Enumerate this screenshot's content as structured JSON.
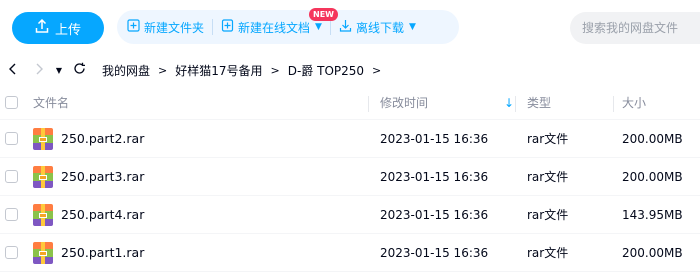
{
  "toolbar": {
    "upload_label": "上传",
    "new_folder_label": "新建文件夹",
    "new_online_doc_label": "新建在线文档",
    "new_badge": "NEW",
    "offline_download_label": "离线下载",
    "search_placeholder": "搜索我的网盘文件"
  },
  "breadcrumb": [
    "我的网盘",
    "好样猫17号备用",
    "D-爵 TOP250"
  ],
  "table": {
    "headers": {
      "name": "文件名",
      "modified": "修改时间",
      "type": "类型",
      "size": "大小"
    },
    "rows": [
      {
        "name": "250.part2.rar",
        "modified": "2023-01-15 16:36",
        "type": "rar文件",
        "size": "200.00MB"
      },
      {
        "name": "250.part3.rar",
        "modified": "2023-01-15 16:36",
        "type": "rar文件",
        "size": "200.00MB"
      },
      {
        "name": "250.part4.rar",
        "modified": "2023-01-15 16:36",
        "type": "rar文件",
        "size": "143.95MB"
      },
      {
        "name": "250.part1.rar",
        "modified": "2023-01-15 16:36",
        "type": "rar文件",
        "size": "200.00MB"
      }
    ]
  },
  "colors": {
    "accent": "#06a7ff",
    "accent_light_bg": "#eef6ff",
    "badge": "#f5365c"
  },
  "icons": {
    "upload": "upload-icon",
    "new_folder": "new-folder-icon",
    "new_doc": "new-document-icon",
    "download": "download-icon",
    "back": "back-arrow-icon",
    "forward": "forward-arrow-icon",
    "history": "history-dropdown-icon",
    "refresh": "refresh-icon",
    "file": "rar-archive-icon",
    "sort": "sort-descending-icon"
  }
}
